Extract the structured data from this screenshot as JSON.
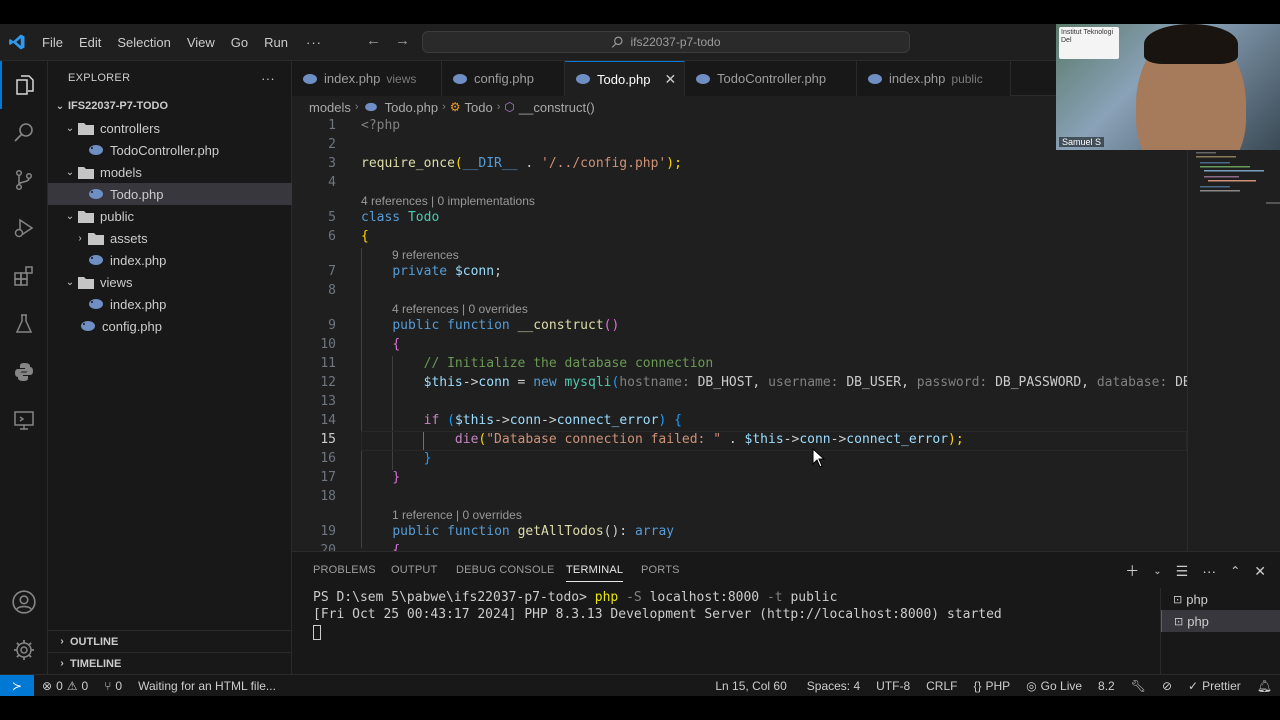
{
  "menu": [
    "File",
    "Edit",
    "Selection",
    "View",
    "Go",
    "Run"
  ],
  "menu_more": "···",
  "command_center": "ifs22037-p7-todo",
  "sidebar": {
    "title": "EXPLORER",
    "more": "···",
    "root": "IFS22037-P7-TODO",
    "items": [
      {
        "label": "controllers",
        "kind": "folder",
        "open": true
      },
      {
        "label": "TodoController.php",
        "kind": "php"
      },
      {
        "label": "models",
        "kind": "folder",
        "open": true
      },
      {
        "label": "Todo.php",
        "kind": "php",
        "selected": true
      },
      {
        "label": "public",
        "kind": "folder",
        "open": true
      },
      {
        "label": "assets",
        "kind": "folder",
        "open": false
      },
      {
        "label": "index.php",
        "kind": "php"
      },
      {
        "label": "views",
        "kind": "folder",
        "open": true
      },
      {
        "label": "index.php",
        "kind": "php"
      },
      {
        "label": "config.php",
        "kind": "php"
      }
    ],
    "outline": "OUTLINE",
    "timeline": "TIMELINE"
  },
  "tabs": [
    {
      "label": "index.php",
      "desc": "views"
    },
    {
      "label": "config.php",
      "desc": ""
    },
    {
      "label": "Todo.php",
      "desc": "",
      "active": true
    },
    {
      "label": "TodoController.php",
      "desc": ""
    },
    {
      "label": "index.php",
      "desc": "public"
    }
  ],
  "tab_close": "✕",
  "breadcrumb": [
    "models",
    "Todo.php",
    "Todo",
    "__construct()"
  ],
  "editor": {
    "current_line": 15,
    "lines": [
      "1",
      "2",
      "3",
      "4",
      "5",
      "6",
      "7",
      "8",
      "9",
      "10",
      "11",
      "12",
      "13",
      "14",
      "15",
      "16",
      "17",
      "18",
      "19",
      "20"
    ],
    "codelens": [
      "4 references | 0 implementations",
      "9 references",
      "4 references | 0 overrides",
      "1 reference | 0 overrides"
    ],
    "code": {
      "l1": "<?php",
      "l3_a": "require_once",
      "l3_b": "(",
      "l3_c": "__DIR__",
      "l3_d": " . ",
      "l3_e": "'/../config.php'",
      "l3_f": ");",
      "l5_a": "class",
      "l5_b": "Todo",
      "l6": "{",
      "l7_a": "private",
      "l7_b": "$conn",
      "l7_c": ";",
      "l9_a": "public",
      "l9_b": "function",
      "l9_c": "__construct",
      "l9_d": "()",
      "l10": "{",
      "l11": "// Initialize the database connection",
      "l12_a": "$this",
      "l12_b": "->",
      "l12_c": "conn",
      "l12_d": " = ",
      "l12_e": "new",
      "l12_f": "mysqli",
      "l12_g": "(",
      "l12_h": "hostname:",
      "l12_i": "DB_HOST",
      "l12_j": ", ",
      "l12_k": "username:",
      "l12_l": "DB_USER",
      "l12_m": ", ",
      "l12_n": "password:",
      "l12_o": "DB_PASSWORD",
      "l12_p": ", ",
      "l12_q": "database:",
      "l12_r": "DB_N",
      "l14_a": "if",
      "l14_b": " (",
      "l14_c": "$this",
      "l14_d": "->",
      "l14_e": "conn",
      "l14_f": "->",
      "l14_g": "connect_error",
      "l14_h": ") {",
      "l15_a": "die",
      "l15_b": "(",
      "l15_c": "\"Database connection failed: \"",
      "l15_d": " . ",
      "l15_e": "$this",
      "l15_f": "->",
      "l15_g": "conn",
      "l15_h": "->",
      "l15_i": "connect_error",
      "l15_j": ");",
      "l16": "}",
      "l17": "}",
      "l19_a": "public",
      "l19_b": "function",
      "l19_c": "getAllTodos",
      "l19_d": "(): ",
      "l19_e": "array",
      "l20": "{"
    }
  },
  "panel": {
    "tabs": [
      "PROBLEMS",
      "OUTPUT",
      "DEBUG CONSOLE",
      "TERMINAL",
      "PORTS"
    ],
    "active_tab": "TERMINAL",
    "terminal": {
      "prompt": "PS D:\\sem 5\\pabwe\\ifs22037-p7-todo> ",
      "cmd": "php",
      "args_flag1": " -S ",
      "args_host": "localhost:8000",
      "args_flag2": " -t ",
      "args_dir": "public",
      "output": "[Fri Oct 25 00:43:17 2024] PHP 8.3.13 Development Server (http://localhost:8000) started"
    },
    "terminals": [
      "php",
      "php"
    ]
  },
  "status": {
    "errors": "0",
    "warnings": "0",
    "ports": "0",
    "message": "Waiting for an HTML file...",
    "position": "Ln 15, Col 60",
    "spaces": "Spaces: 4",
    "encoding": "UTF-8",
    "eol": "CRLF",
    "language": "PHP",
    "golive": "Go Live",
    "version": "8.2",
    "prettier": "Prettier"
  },
  "webcam": {
    "name": "Samuel S",
    "logo_text": "Institut Teknologi Del"
  },
  "colors": {
    "accent": "#0078d4",
    "editor_bg": "#1f1f1f",
    "sidebar_bg": "#181818"
  }
}
